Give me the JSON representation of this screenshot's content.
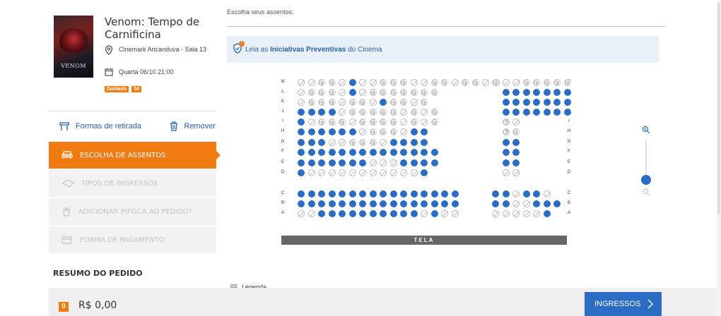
{
  "movie": {
    "title": "Venom: Tempo de Carnificina",
    "poster_text": "VENOM",
    "cinema": "Cinemark Aricanduva - Sala 13",
    "datetime": "Quarta 06/10 21:00",
    "tags": [
      "Dublado",
      "3d"
    ]
  },
  "actions": {
    "withdraw": "Formas de retirada",
    "remove": "Remover"
  },
  "steps": [
    {
      "label": "Escolha de assentos",
      "active": true
    },
    {
      "label": "Tipos de ingressos",
      "active": false
    },
    {
      "label": "Adicionar pipoca ao pedido?",
      "active": false
    },
    {
      "label": "Forma de pagamento",
      "active": false
    }
  ],
  "summary_title": "RESUMO DO PEDIDO",
  "seat_header": "Escolha seus assentos:",
  "banner": {
    "prefix": "Leia as ",
    "link": "Iniciativas Preventivas",
    "suffix": " do Cinema",
    "badge": "!"
  },
  "screen_label": "TELA",
  "legend_label": "Legenda",
  "footer": {
    "count": "0",
    "price": "R$ 0,00",
    "button": "INGRESSOS"
  },
  "seat_rows": [
    {
      "label": "M",
      "left": "xxddxaxxdddxxddxddxxdd",
      "right": "dxxddddd",
      "right_gap": 0
    },
    {
      "label": "L",
      "left": "xdddxaxddddddd",
      "right": "aaaaaaa",
      "right_gap": 1
    },
    {
      "label": "K",
      "left": "xdddxddxaddxd",
      "right": "aaaaaaa",
      "right_gap": 1
    },
    {
      "label": "J",
      "left": "aaaaxdddddxdxd",
      "right": "aaaaaaa",
      "right_gap": 1
    },
    {
      "label": "I",
      "left": "axdddxddddxdxd",
      "right": "cx",
      "right_gap": 1
    },
    {
      "label": "H",
      "left": "aaaaaaxdddxaa",
      "right": "cd",
      "right_gap": 1
    },
    {
      "label": "G",
      "left": "aaaxxdddxaaaa",
      "right": "aa",
      "right_gap": 1
    },
    {
      "label": "F",
      "left": "aaaaaaaaaaaaaa",
      "right": "aa",
      "right_gap": 1
    },
    {
      "label": "E",
      "left": "aaaaaaaxxxaaaa",
      "right": "aa",
      "right_gap": 1
    },
    {
      "label": "D",
      "left": "axxxxxxxxxxxa",
      "right": "xx",
      "right_gap": 1
    },
    {
      "label": "C",
      "left": "aaaaaaaaaaaaaaaa",
      "right": "aaxaax",
      "right_gap": 0
    },
    {
      "label": "B",
      "left": "aaaaaaaaaaaaaaaa",
      "right": "aaxxaaa",
      "right_gap": 0
    },
    {
      "label": "A",
      "left": "xxaaaaaaaaaaxaxx",
      "right": "xxxxxa",
      "right_gap": 0
    }
  ],
  "colors": {
    "accent": "#f07b10",
    "available": "#2b6cc4",
    "link": "#2b5fa8"
  },
  "icons": [
    "location-pin-icon",
    "calendar-icon",
    "ticket-stand-icon",
    "trash-icon",
    "seat-icon",
    "ticket-icon",
    "popcorn-icon",
    "card-icon",
    "shield-icon",
    "zoom-in-icon",
    "zoom-out-icon",
    "list-icon",
    "chevron-right-icon"
  ]
}
